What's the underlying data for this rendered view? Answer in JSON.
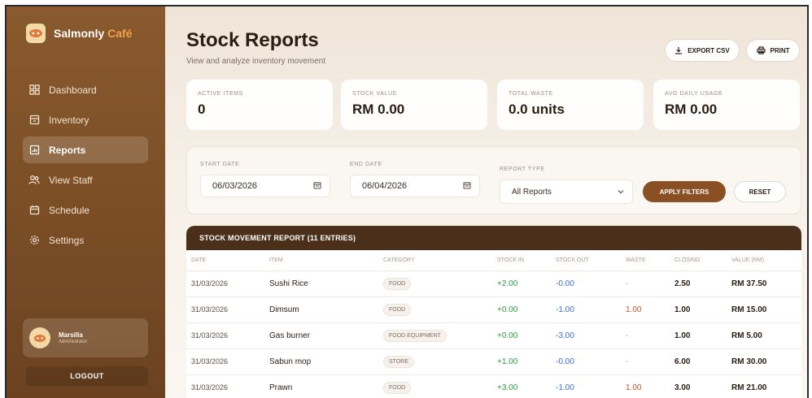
{
  "brand": {
    "name_main": "Salmonly",
    "name_accent": "Café",
    "logo_icon": "cafe-logo-icon"
  },
  "sidebar": {
    "items": [
      {
        "label": "Dashboard",
        "icon": "dashboard-icon",
        "active": false
      },
      {
        "label": "Inventory",
        "icon": "inventory-icon",
        "active": false
      },
      {
        "label": "Reports",
        "icon": "reports-icon",
        "active": true
      },
      {
        "label": "View Staff",
        "icon": "staff-icon",
        "active": false
      },
      {
        "label": "Schedule",
        "icon": "calendar-icon",
        "active": false
      },
      {
        "label": "Settings",
        "icon": "gear-icon",
        "active": false
      }
    ],
    "user": {
      "name": "Marsilla",
      "role": "Administrator"
    },
    "logout_label": "LOGOUT"
  },
  "header": {
    "title": "Stock Reports",
    "subtitle": "View and analyze inventory movement",
    "export_label": "EXPORT CSV",
    "print_label": "PRINT"
  },
  "stats": [
    {
      "label": "ACTIVE ITEMS",
      "value": "0"
    },
    {
      "label": "STOCK VALUE",
      "value": "RM 0.00"
    },
    {
      "label": "TOTAL WASTE",
      "value": "0.0 units"
    },
    {
      "label": "AVG DAILY USAGE",
      "value": "RM 0.00"
    }
  ],
  "filters": {
    "start_label": "START DATE",
    "start_value": "06/03/2026",
    "end_label": "END DATE",
    "end_value": "06/04/2026",
    "type_label": "REPORT TYPE",
    "type_value": "All Reports",
    "apply_label": "APPLY FILTERS",
    "reset_label": "RESET"
  },
  "table": {
    "title": "STOCK MOVEMENT REPORT (11 ENTRIES)",
    "columns": [
      "DATE",
      "ITEM",
      "CATEGORY",
      "STOCK IN",
      "STOCK OUT",
      "WASTE",
      "CLOSING",
      "VALUE (RM)"
    ],
    "rows": [
      {
        "date": "31/03/2026",
        "item": "Sushi Rice",
        "category": "FOOD",
        "stock_in": "+2.00",
        "stock_out": "-0.00",
        "waste": "-",
        "closing": "2.50",
        "value": "RM 37.50"
      },
      {
        "date": "31/03/2026",
        "item": "Dimsum",
        "category": "FOOD",
        "stock_in": "+0.00",
        "stock_out": "-1.00",
        "waste": "1.00",
        "closing": "1.00",
        "value": "RM 15.00"
      },
      {
        "date": "31/03/2026",
        "item": "Gas burner",
        "category": "FOOD EQUIPMENT",
        "stock_in": "+0.00",
        "stock_out": "-3.00",
        "waste": "-",
        "closing": "1.00",
        "value": "RM 5.00"
      },
      {
        "date": "31/03/2026",
        "item": "Sabun mop",
        "category": "STORE",
        "stock_in": "+1.00",
        "stock_out": "-0.00",
        "waste": "-",
        "closing": "6.00",
        "value": "RM 30.00"
      },
      {
        "date": "31/03/2026",
        "item": "Prawn",
        "category": "FOOD",
        "stock_in": "+3.00",
        "stock_out": "-1.00",
        "waste": "1.00",
        "closing": "3.00",
        "value": "RM 21.00"
      }
    ]
  },
  "colors": {
    "sidebar": "#7a4d26",
    "accent": "#f0a14a",
    "apply_button": "#8a4f22",
    "table_header": "#4a2f1a",
    "positive": "#2f9a3e",
    "negative": "#3a6fcf",
    "waste": "#c0552a"
  }
}
